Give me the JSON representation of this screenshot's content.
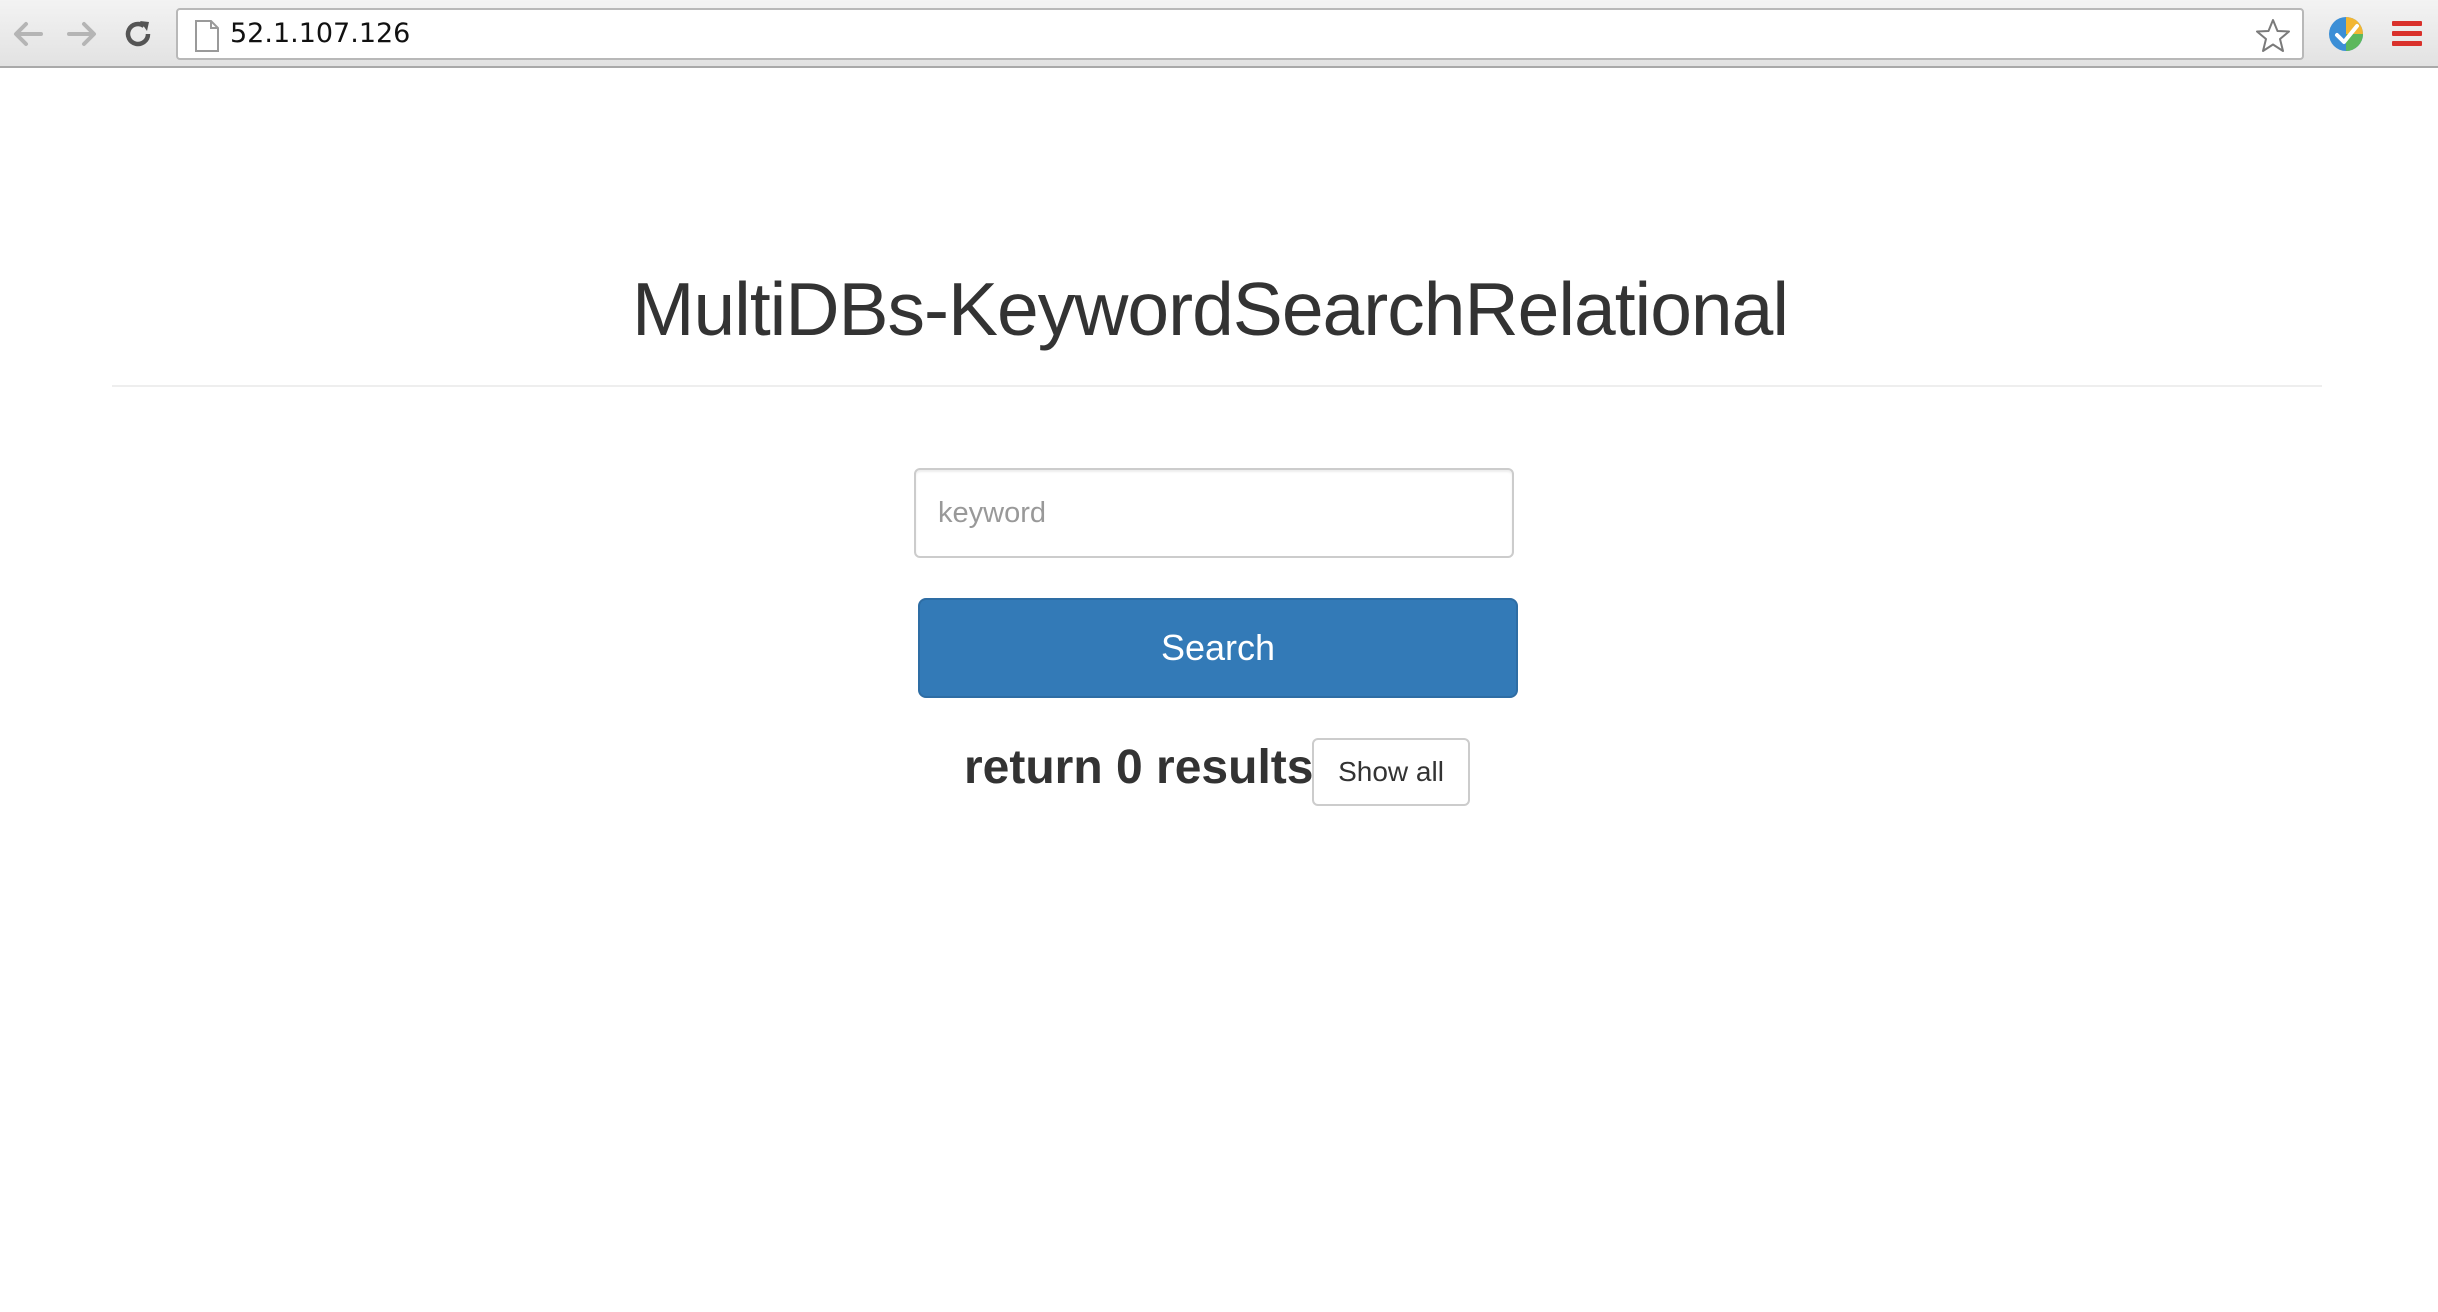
{
  "browser": {
    "url": "52.1.107.126",
    "icons": {
      "back": "arrow-left-icon",
      "forward": "arrow-right-icon",
      "reload": "reload-icon",
      "page": "page-icon",
      "bookmark": "star-icon",
      "extension": "extension-icon",
      "menu": "hamburger-menu-icon"
    }
  },
  "page": {
    "title": "MultiDBs-KeywordSearchRelational",
    "search": {
      "placeholder": "keyword",
      "value": "",
      "button_label": "Search"
    },
    "results": {
      "summary": "return 0 results",
      "show_all_label": "Show all"
    }
  },
  "colors": {
    "primary_button": "#337ab7",
    "title_text": "#333333",
    "menu_icon": "#d9312b"
  }
}
